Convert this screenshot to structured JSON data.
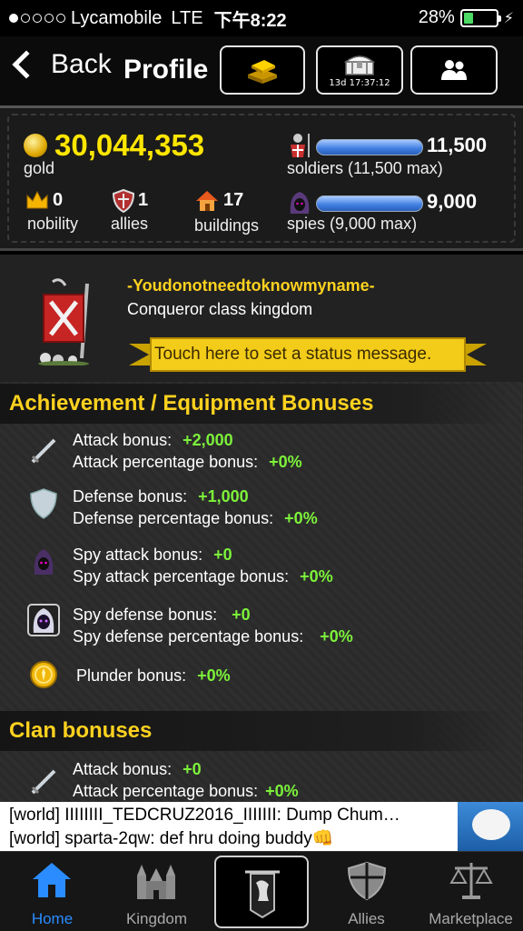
{
  "status_bar": {
    "carrier": "Lycamobile",
    "network": "LTE",
    "time": "下午8:22",
    "battery": "28%",
    "battery_level": 0.28
  },
  "nav": {
    "back_label": "Back",
    "title": "Profile",
    "chest_timer": "13d 17:37:12"
  },
  "stats": {
    "gold_value": "30,044,353",
    "gold_label": "gold",
    "nobility_value": "0",
    "nobility_label": "nobility",
    "allies_value": "1",
    "allies_label": "allies",
    "buildings_value": "17",
    "buildings_label": "buildings",
    "soldiers_value": "11,500",
    "soldiers_label": "soldiers (11,500 max)",
    "soldiers_fill": 1.0,
    "spies_value": "9,000",
    "spies_label": "spies (9,000 max)",
    "spies_fill": 1.0
  },
  "kingdom": {
    "name": "-Youdonotneedtoknowmyname-",
    "class": "Conqueror class kingdom",
    "status_prompt": "Touch here to set a status message."
  },
  "bonuses": {
    "header": "Achievement / Equipment Bonuses",
    "attack_label": "Attack bonus:",
    "attack_value": "+2,000",
    "attack_pct_label": "Attack percentage bonus:",
    "attack_pct_value": "+0%",
    "defense_label": "Defense bonus:",
    "defense_value": "+1,000",
    "defense_pct_label": "Defense percentage bonus:",
    "defense_pct_value": "+0%",
    "spy_attack_label": "Spy attack bonus:",
    "spy_attack_value": "+0",
    "spy_attack_pct_label": "Spy attack percentage bonus:",
    "spy_attack_pct_value": "+0%",
    "spy_defense_label": "Spy defense bonus:",
    "spy_defense_value": "+0",
    "spy_defense_pct_label": "Spy defense percentage bonus:",
    "spy_defense_pct_value": "+0%",
    "plunder_label": "Plunder bonus:",
    "plunder_value": "+0%"
  },
  "clan": {
    "header": "Clan bonuses",
    "attack_label": "Attack bonus:",
    "attack_value": "+0",
    "attack_pct_label": "Attack percentage bonus:",
    "attack_pct_value": "+0%"
  },
  "chat": {
    "line1": "[world] IIIIIIII_TEDCRUZ2016_IIIIIII: Dump Chum…",
    "line2": "[world] sparta-2qw: def hru doing buddy👊"
  },
  "tabs": {
    "home": "Home",
    "kingdom": "Kingdom",
    "allies": "Allies",
    "marketplace": "Marketplace"
  },
  "colors": {
    "gold_text": "#ffe600",
    "header_text": "#ffd21f",
    "bonus_green": "#7cf23a",
    "tab_active": "#2a8cff"
  }
}
